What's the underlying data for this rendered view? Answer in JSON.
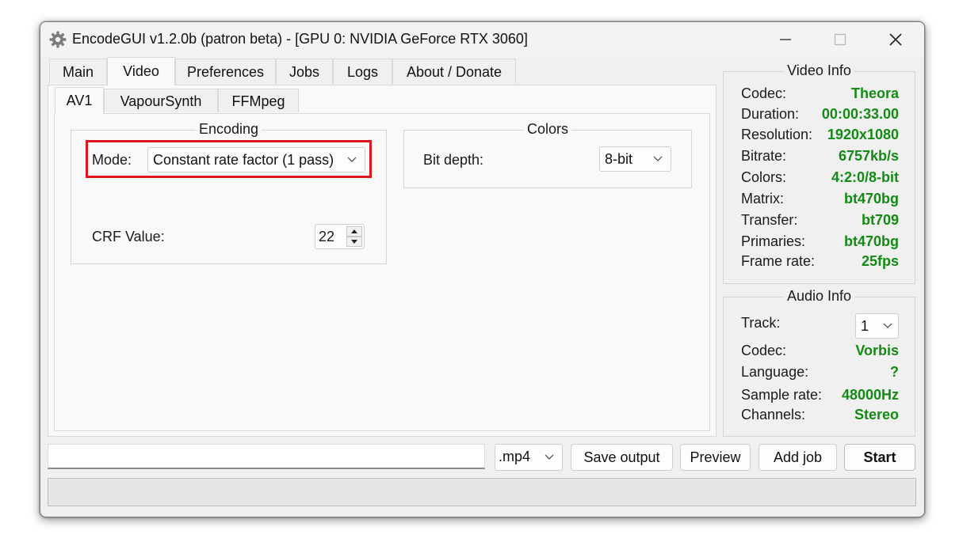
{
  "window": {
    "title": "EncodeGUI v1.2.0b (patron beta) - [GPU 0: NVIDIA GeForce RTX 3060]",
    "icon": "gear-icon"
  },
  "main_tabs": [
    "Main",
    "Video",
    "Preferences",
    "Jobs",
    "Logs",
    "About / Donate"
  ],
  "sub_tabs": [
    "AV1",
    "VapourSynth",
    "FFMpeg"
  ],
  "encoding": {
    "title": "Encoding",
    "mode_label": "Mode:",
    "mode_value": "Constant rate factor (1 pass)",
    "crf_label": "CRF Value:",
    "crf_value": "22",
    "highlight_color": "#e0141a"
  },
  "colors": {
    "title": "Colors",
    "bit_depth_label": "Bit depth:",
    "bit_depth_value": "8-bit"
  },
  "video_info": {
    "title": "Video Info",
    "rows": [
      {
        "k": "Codec:",
        "v": "Theora"
      },
      {
        "k": "Duration:",
        "v": "00:00:33.00"
      },
      {
        "k": "Resolution:",
        "v": "1920x1080"
      },
      {
        "k": "Bitrate:",
        "v": "6757kb/s"
      },
      {
        "k": "Colors:",
        "v": "4:2:0/8-bit"
      },
      {
        "k": "Matrix:",
        "v": "bt470bg"
      },
      {
        "k": "Transfer:",
        "v": "bt709"
      },
      {
        "k": "Primaries:",
        "v": "bt470bg"
      },
      {
        "k": "Frame rate:",
        "v": "25fps"
      }
    ]
  },
  "audio_info": {
    "title": "Audio Info",
    "track_label": "Track:",
    "track_value": "1",
    "rows": [
      {
        "k": "Codec:",
        "v": "Vorbis"
      },
      {
        "k": "Language:",
        "v": "?"
      },
      {
        "k": "Sample rate:",
        "v": "48000Hz"
      },
      {
        "k": "Channels:",
        "v": "Stereo"
      }
    ]
  },
  "bottom": {
    "output_path": "",
    "container": ".mp4",
    "save_output": "Save output",
    "preview": "Preview",
    "add_job": "Add job",
    "start": "Start"
  },
  "value_color": "#138a13"
}
